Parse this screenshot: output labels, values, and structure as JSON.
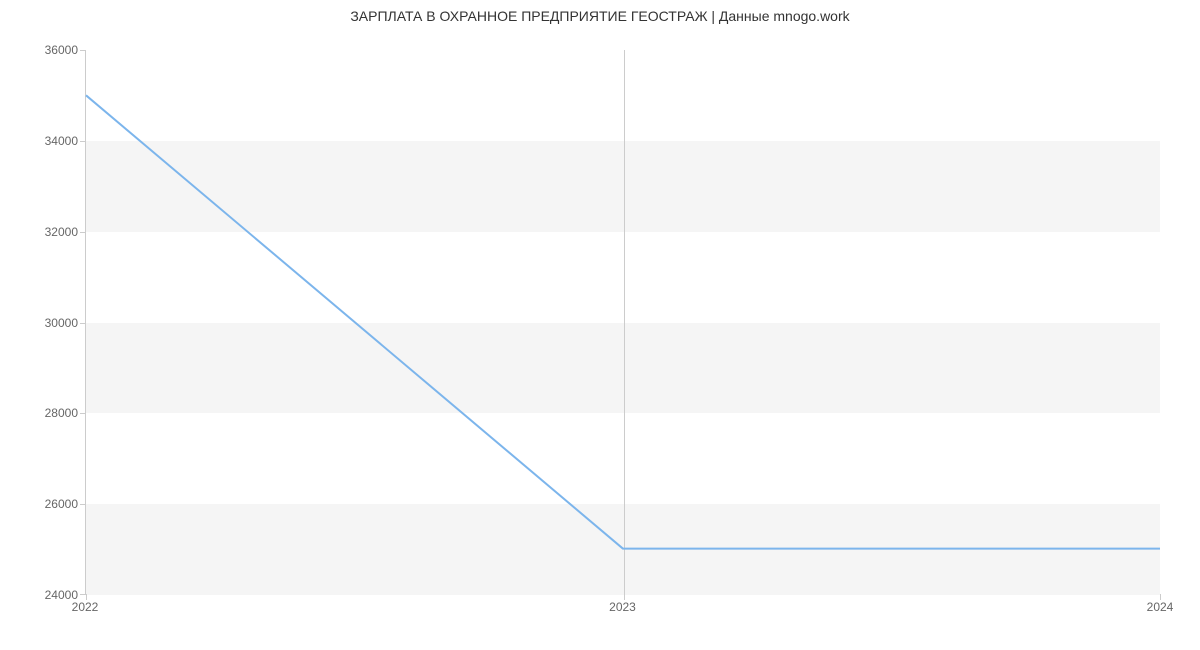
{
  "chart_data": {
    "type": "line",
    "title": "ЗАРПЛАТА В  ОХРАННОЕ ПРЕДПРИЯТИЕ ГЕОСТРАЖ | Данные mnogo.work",
    "x": [
      2022,
      2023,
      2024
    ],
    "values": [
      35000,
      25000,
      25000
    ],
    "xlabel": "",
    "ylabel": "",
    "ylim": [
      24000,
      36000
    ],
    "y_ticks": [
      24000,
      26000,
      28000,
      30000,
      32000,
      34000,
      36000
    ],
    "x_ticks": [
      2022,
      2023,
      2024
    ],
    "line_color": "#7cb5ec",
    "band_color": "#f5f5f5"
  }
}
